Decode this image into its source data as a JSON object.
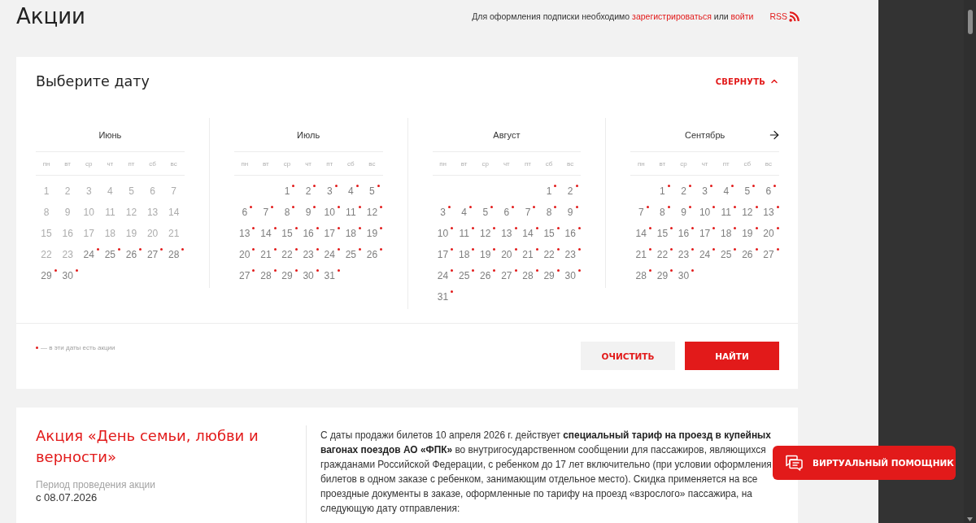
{
  "page": {
    "title": "Акции"
  },
  "subscription": {
    "text": "Для оформления подписки необходимо",
    "register_link": "зарегистрироваться",
    "middle": "или",
    "login_link": "войти"
  },
  "rss": {
    "label": "RSS"
  },
  "date_picker": {
    "title": "Выберите дату",
    "collapse": {
      "label": "СВЕРНУТЬ",
      "expanded": true
    },
    "months": [
      {
        "name": "Июнь",
        "weekdays": [
          "пн",
          "вт",
          "ср",
          "чт",
          "пт",
          "сб",
          "вс"
        ],
        "weeks": [
          [
            {
              "day": "1",
              "disabled": true,
              "promo": false
            },
            {
              "day": "2",
              "disabled": true,
              "promo": false
            },
            {
              "day": "3",
              "disabled": true,
              "promo": false
            },
            {
              "day": "4",
              "disabled": true,
              "promo": false
            },
            {
              "day": "5",
              "disabled": true,
              "promo": false
            },
            {
              "day": "6",
              "disabled": true,
              "promo": false
            },
            {
              "day": "7",
              "disabled": true,
              "promo": false
            }
          ],
          [
            {
              "day": "8",
              "disabled": true,
              "promo": false
            },
            {
              "day": "9",
              "disabled": true,
              "promo": false
            },
            {
              "day": "10",
              "disabled": true,
              "promo": false
            },
            {
              "day": "11",
              "disabled": true,
              "promo": false
            },
            {
              "day": "12",
              "disabled": true,
              "promo": false
            },
            {
              "day": "13",
              "disabled": true,
              "promo": false
            },
            {
              "day": "14",
              "disabled": true,
              "promo": false
            }
          ],
          [
            {
              "day": "15",
              "disabled": true,
              "promo": false
            },
            {
              "day": "16",
              "disabled": true,
              "promo": false
            },
            {
              "day": "17",
              "disabled": true,
              "promo": false
            },
            {
              "day": "18",
              "disabled": true,
              "promo": false
            },
            {
              "day": "19",
              "disabled": true,
              "promo": false
            },
            {
              "day": "20",
              "disabled": true,
              "promo": false
            },
            {
              "day": "21",
              "disabled": true,
              "promo": false
            }
          ],
          [
            {
              "day": "22",
              "disabled": true,
              "promo": false
            },
            {
              "day": "23",
              "disabled": true,
              "promo": false
            },
            {
              "day": "24",
              "disabled": false,
              "promo": true
            },
            {
              "day": "25",
              "disabled": false,
              "promo": true
            },
            {
              "day": "26",
              "disabled": false,
              "promo": true
            },
            {
              "day": "27",
              "disabled": false,
              "promo": true
            },
            {
              "day": "28",
              "disabled": false,
              "promo": true
            }
          ],
          [
            {
              "day": "29",
              "disabled": false,
              "promo": true
            },
            {
              "day": "30",
              "disabled": false,
              "promo": true
            }
          ]
        ]
      },
      {
        "name": "Июль",
        "weekdays": [
          "пн",
          "вт",
          "ср",
          "чт",
          "пт",
          "сб",
          "вс"
        ],
        "weeks": [
          [
            {
              "day": "1",
              "disabled": false,
              "promo": true
            },
            {
              "day": "2",
              "disabled": false,
              "promo": true
            },
            {
              "day": "3",
              "disabled": false,
              "promo": true
            },
            {
              "day": "4",
              "disabled": false,
              "promo": true
            },
            {
              "day": "5",
              "disabled": false,
              "promo": true
            }
          ],
          [
            {
              "day": "6",
              "disabled": false,
              "promo": true
            },
            {
              "day": "7",
              "disabled": false,
              "promo": true
            },
            {
              "day": "8",
              "disabled": false,
              "promo": true
            },
            {
              "day": "9",
              "disabled": false,
              "promo": true
            },
            {
              "day": "10",
              "disabled": false,
              "promo": true
            },
            {
              "day": "11",
              "disabled": false,
              "promo": true
            },
            {
              "day": "12",
              "disabled": false,
              "promo": true
            }
          ],
          [
            {
              "day": "13",
              "disabled": false,
              "promo": true
            },
            {
              "day": "14",
              "disabled": false,
              "promo": true
            },
            {
              "day": "15",
              "disabled": false,
              "promo": true
            },
            {
              "day": "16",
              "disabled": false,
              "promo": true
            },
            {
              "day": "17",
              "disabled": false,
              "promo": true
            },
            {
              "day": "18",
              "disabled": false,
              "promo": true
            },
            {
              "day": "19",
              "disabled": false,
              "promo": true
            }
          ],
          [
            {
              "day": "20",
              "disabled": false,
              "promo": true
            },
            {
              "day": "21",
              "disabled": false,
              "promo": true
            },
            {
              "day": "22",
              "disabled": false,
              "promo": true
            },
            {
              "day": "23",
              "disabled": false,
              "promo": true
            },
            {
              "day": "24",
              "disabled": false,
              "promo": true
            },
            {
              "day": "25",
              "disabled": false,
              "promo": true
            },
            {
              "day": "26",
              "disabled": false,
              "promo": true
            }
          ],
          [
            {
              "day": "27",
              "disabled": false,
              "promo": true
            },
            {
              "day": "28",
              "disabled": false,
              "promo": true
            },
            {
              "day": "29",
              "disabled": false,
              "promo": true
            },
            {
              "day": "30",
              "disabled": false,
              "promo": true
            },
            {
              "day": "31",
              "disabled": false,
              "promo": true
            }
          ]
        ]
      },
      {
        "name": "Август",
        "weekdays": [
          "пн",
          "вт",
          "ср",
          "чт",
          "пт",
          "сб",
          "вс"
        ],
        "weeks": [
          [
            {
              "day": "1",
              "disabled": false,
              "promo": true
            },
            {
              "day": "2",
              "disabled": false,
              "promo": true
            }
          ],
          [
            {
              "day": "3",
              "disabled": false,
              "promo": true
            },
            {
              "day": "4",
              "disabled": false,
              "promo": true
            },
            {
              "day": "5",
              "disabled": false,
              "promo": true
            },
            {
              "day": "6",
              "disabled": false,
              "promo": true
            },
            {
              "day": "7",
              "disabled": false,
              "promo": true
            },
            {
              "day": "8",
              "disabled": false,
              "promo": true
            },
            {
              "day": "9",
              "disabled": false,
              "promo": true
            }
          ],
          [
            {
              "day": "10",
              "disabled": false,
              "promo": true
            },
            {
              "day": "11",
              "disabled": false,
              "promo": true
            },
            {
              "day": "12",
              "disabled": false,
              "promo": true
            },
            {
              "day": "13",
              "disabled": false,
              "promo": true
            },
            {
              "day": "14",
              "disabled": false,
              "promo": true
            },
            {
              "day": "15",
              "disabled": false,
              "promo": true
            },
            {
              "day": "16",
              "disabled": false,
              "promo": true
            }
          ],
          [
            {
              "day": "17",
              "disabled": false,
              "promo": true
            },
            {
              "day": "18",
              "disabled": false,
              "promo": true
            },
            {
              "day": "19",
              "disabled": false,
              "promo": true
            },
            {
              "day": "20",
              "disabled": false,
              "promo": true
            },
            {
              "day": "21",
              "disabled": false,
              "promo": true
            },
            {
              "day": "22",
              "disabled": false,
              "promo": true
            },
            {
              "day": "23",
              "disabled": false,
              "promo": true
            }
          ],
          [
            {
              "day": "24",
              "disabled": false,
              "promo": true
            },
            {
              "day": "25",
              "disabled": false,
              "promo": true
            },
            {
              "day": "26",
              "disabled": false,
              "promo": true
            },
            {
              "day": "27",
              "disabled": false,
              "promo": true
            },
            {
              "day": "28",
              "disabled": false,
              "promo": true
            },
            {
              "day": "29",
              "disabled": false,
              "promo": true
            },
            {
              "day": "30",
              "disabled": false,
              "promo": true
            }
          ],
          [
            {
              "day": "31",
              "disabled": false,
              "promo": true
            }
          ]
        ]
      },
      {
        "name": "Сентябрь",
        "weekdays": [
          "пн",
          "вт",
          "ср",
          "чт",
          "пт",
          "сб",
          "вс"
        ],
        "weeks": [
          [
            {
              "day": "1",
              "disabled": false,
              "promo": true
            },
            {
              "day": "2",
              "disabled": false,
              "promo": true
            },
            {
              "day": "3",
              "disabled": false,
              "promo": true
            },
            {
              "day": "4",
              "disabled": false,
              "promo": true
            },
            {
              "day": "5",
              "disabled": false,
              "promo": true
            },
            {
              "day": "6",
              "disabled": false,
              "promo": true
            }
          ],
          [
            {
              "day": "7",
              "disabled": false,
              "promo": true
            },
            {
              "day": "8",
              "disabled": false,
              "promo": true
            },
            {
              "day": "9",
              "disabled": false,
              "promo": true
            },
            {
              "day": "10",
              "disabled": false,
              "promo": true
            },
            {
              "day": "11",
              "disabled": false,
              "promo": true
            },
            {
              "day": "12",
              "disabled": false,
              "promo": true
            },
            {
              "day": "13",
              "disabled": false,
              "promo": true
            }
          ],
          [
            {
              "day": "14",
              "disabled": false,
              "promo": true
            },
            {
              "day": "15",
              "disabled": false,
              "promo": true
            },
            {
              "day": "16",
              "disabled": false,
              "promo": true
            },
            {
              "day": "17",
              "disabled": false,
              "promo": true
            },
            {
              "day": "18",
              "disabled": false,
              "promo": true
            },
            {
              "day": "19",
              "disabled": false,
              "promo": true
            },
            {
              "day": "20",
              "disabled": false,
              "promo": true
            }
          ],
          [
            {
              "day": "21",
              "disabled": false,
              "promo": true
            },
            {
              "day": "22",
              "disabled": false,
              "promo": true
            },
            {
              "day": "23",
              "disabled": false,
              "promo": true
            },
            {
              "day": "24",
              "disabled": false,
              "promo": true
            },
            {
              "day": "25",
              "disabled": false,
              "promo": true
            },
            {
              "day": "26",
              "disabled": false,
              "promo": true
            },
            {
              "day": "27",
              "disabled": false,
              "promo": true
            }
          ],
          [
            {
              "day": "28",
              "disabled": false,
              "promo": true
            },
            {
              "day": "29",
              "disabled": false,
              "promo": true
            },
            {
              "day": "30",
              "disabled": false,
              "promo": true
            }
          ]
        ]
      }
    ],
    "legend": {
      "text": "— в эти даты есть акции"
    },
    "buttons": [
      {
        "label": "ОЧИСТИТЬ",
        "kind": "secondary"
      },
      {
        "label": "НАЙТИ",
        "kind": "primary"
      }
    ]
  },
  "promotions": [
    {
      "title": "Акция «День семьи, любви и верности»",
      "period_label": "Период проведения акции",
      "period": "с 08.07.2026",
      "description": "С даты продажи билетов 10 апреля 2026 г. действует **специальный тариф на проезд в купейных вагонах поездов АО «ФПК»** во внутригосударственном сообщении для пассажиров, являющихся гражданами Российской Федерации, с ребенком до 17 лет включительно (при условии оформления билетов в одном заказе с ребенком, занимающим отдельное место). Скидка применяется на все проездные документы в заказе, оформленные по тарифу на проезд «взрослого» пассажира, на следующую дату отправления:"
    }
  ],
  "assistant_button": {
    "label": "ВИРТУАЛЬНЫЙ ПОМОЩНИК"
  }
}
